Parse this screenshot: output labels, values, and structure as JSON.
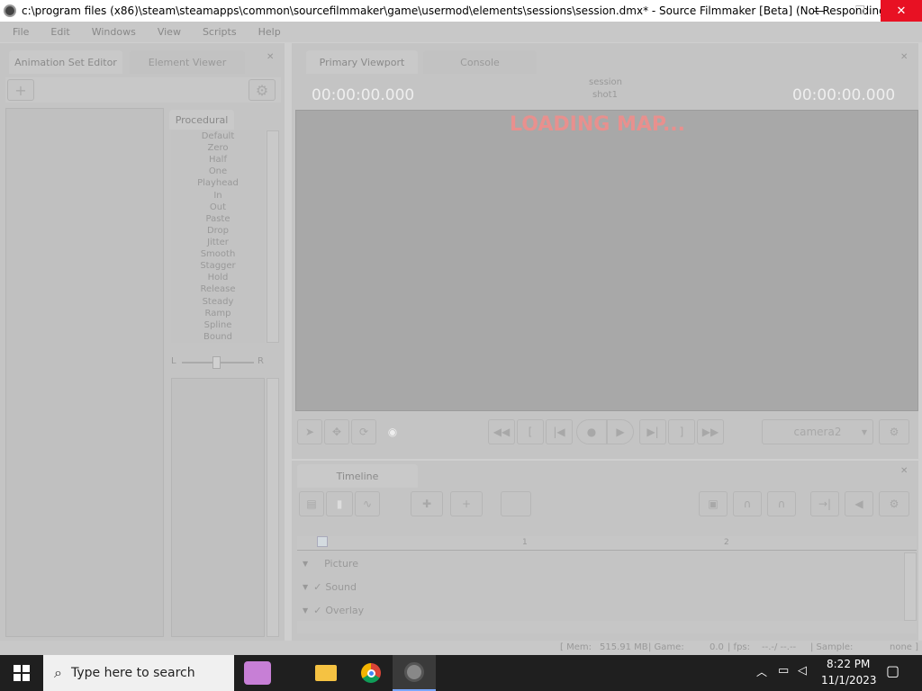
{
  "window": {
    "title": "c:\\program files (x86)\\steam\\steamapps\\common\\sourcefilmmaker\\game\\usermod\\elements\\sessions\\session.dmx* - Source Filmmaker [Beta] (Not Responding)",
    "minimize": "—",
    "maximize": "❐",
    "close": "✕"
  },
  "menu": [
    "File",
    "Edit",
    "Windows",
    "View",
    "Scripts",
    "Help"
  ],
  "left_panel": {
    "tabs": [
      "Animation Set Editor",
      "Element Viewer"
    ],
    "add_label": "+",
    "procedural_tab": "Procedural",
    "procedural_items": [
      "Default",
      "Zero",
      "Half",
      "One",
      "Playhead",
      "In",
      "Out",
      "Paste",
      "Drop",
      "Jitter",
      "Smooth",
      "Stagger",
      "Hold",
      "Release",
      "Steady",
      "Ramp",
      "Spline",
      "Bound"
    ],
    "balance_left": "L",
    "balance_right": "R"
  },
  "viewport": {
    "tabs": [
      "Primary Viewport",
      "Console"
    ],
    "time_left": "00:00:00.000",
    "time_right": "00:00:00.000",
    "session_label": "session",
    "shot_label": "shot1",
    "loading_text": "LOADING MAP...",
    "camera": "camera2"
  },
  "timeline": {
    "tab": "Timeline",
    "tracks": [
      "Picture",
      "Sound",
      "Overlay"
    ],
    "ruler_marks": [
      "1",
      "2"
    ]
  },
  "status_bar": {
    "mem_label": "[ Mem:",
    "mem_value": "515.91 MB",
    "game_label": "| Game:",
    "game_value": "0.0",
    "fps_label": "| fps:",
    "fps_value": "--.-/ --.--",
    "sample_label": "| Sample:",
    "sample_value": "none ]"
  },
  "taskbar": {
    "search_placeholder": "Type here to search",
    "time": "8:22 PM",
    "date": "11/1/2023"
  },
  "colors": {
    "loading": "#e8908e",
    "close_hover": "#e81123",
    "taskbar": "#1f1f1f"
  }
}
